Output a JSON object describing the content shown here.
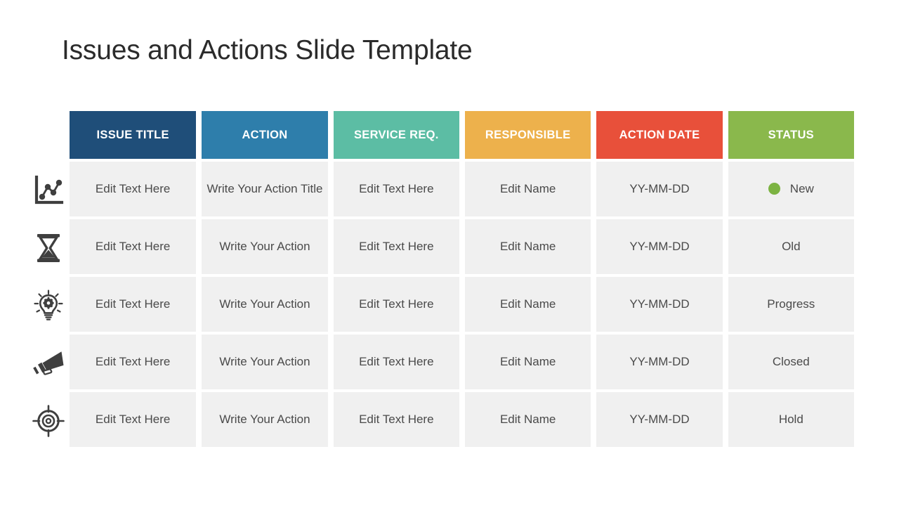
{
  "slide": {
    "title": "Issues and Actions Slide Template",
    "background": "#ffffff"
  },
  "table": {
    "headers": [
      {
        "label": "ISSUE TITLE",
        "color": "#1f4e79"
      },
      {
        "label": "ACTION",
        "color": "#2e7eab"
      },
      {
        "label": "SERVICE REQ.",
        "color": "#5cbda4"
      },
      {
        "label": "RESPONSIBLE",
        "color": "#efb košice"
      },
      {
        "label": "ACTION DATE",
        "color": "#e8503a"
      },
      {
        "label": "STATUS",
        "color": "#8ab84c"
      }
    ],
    "header_colors": [
      "#1f4e79",
      "#2e7eab",
      "#5cbda4",
      "#edb14c",
      "#e8503a",
      "#8ab84c"
    ],
    "cell_background": "#f0f0f0",
    "rows": [
      {
        "icon": "line-chart-icon",
        "issue_title": "Edit Text Here",
        "action": "Write Your Action Title",
        "service_req": "Edit Text Here",
        "responsible": "Edit Name",
        "action_date": "YY-MM-DD",
        "status": "New",
        "status_dot": true,
        "status_dot_color": "#7cb342"
      },
      {
        "icon": "hourglass-icon",
        "issue_title": "Edit Text Here",
        "action": "Write Your Action",
        "service_req": "Edit Text Here",
        "responsible": "Edit Name",
        "action_date": "YY-MM-DD",
        "status": "Old",
        "status_dot": false,
        "status_dot_color": ""
      },
      {
        "icon": "lightbulb-gear-icon",
        "issue_title": "Edit Text Here",
        "action": "Write Your Action",
        "service_req": "Edit Text Here",
        "responsible": "Edit Name",
        "action_date": "YY-MM-DD",
        "status": "Progress",
        "status_dot": false,
        "status_dot_color": ""
      },
      {
        "icon": "megaphone-icon",
        "issue_title": "Edit Text Here",
        "action": "Write Your Action",
        "service_req": "Edit Text Here",
        "responsible": "Edit Name",
        "action_date": "YY-MM-DD",
        "status": "Closed",
        "status_dot": false,
        "status_dot_color": ""
      },
      {
        "icon": "target-icon",
        "issue_title": "Edit Text Here",
        "action": "Write Your Action",
        "service_req": "Edit Text Here",
        "responsible": "Edit Name",
        "action_date": "YY-MM-DD",
        "status": "Hold",
        "status_dot": false,
        "status_dot_color": ""
      }
    ]
  }
}
